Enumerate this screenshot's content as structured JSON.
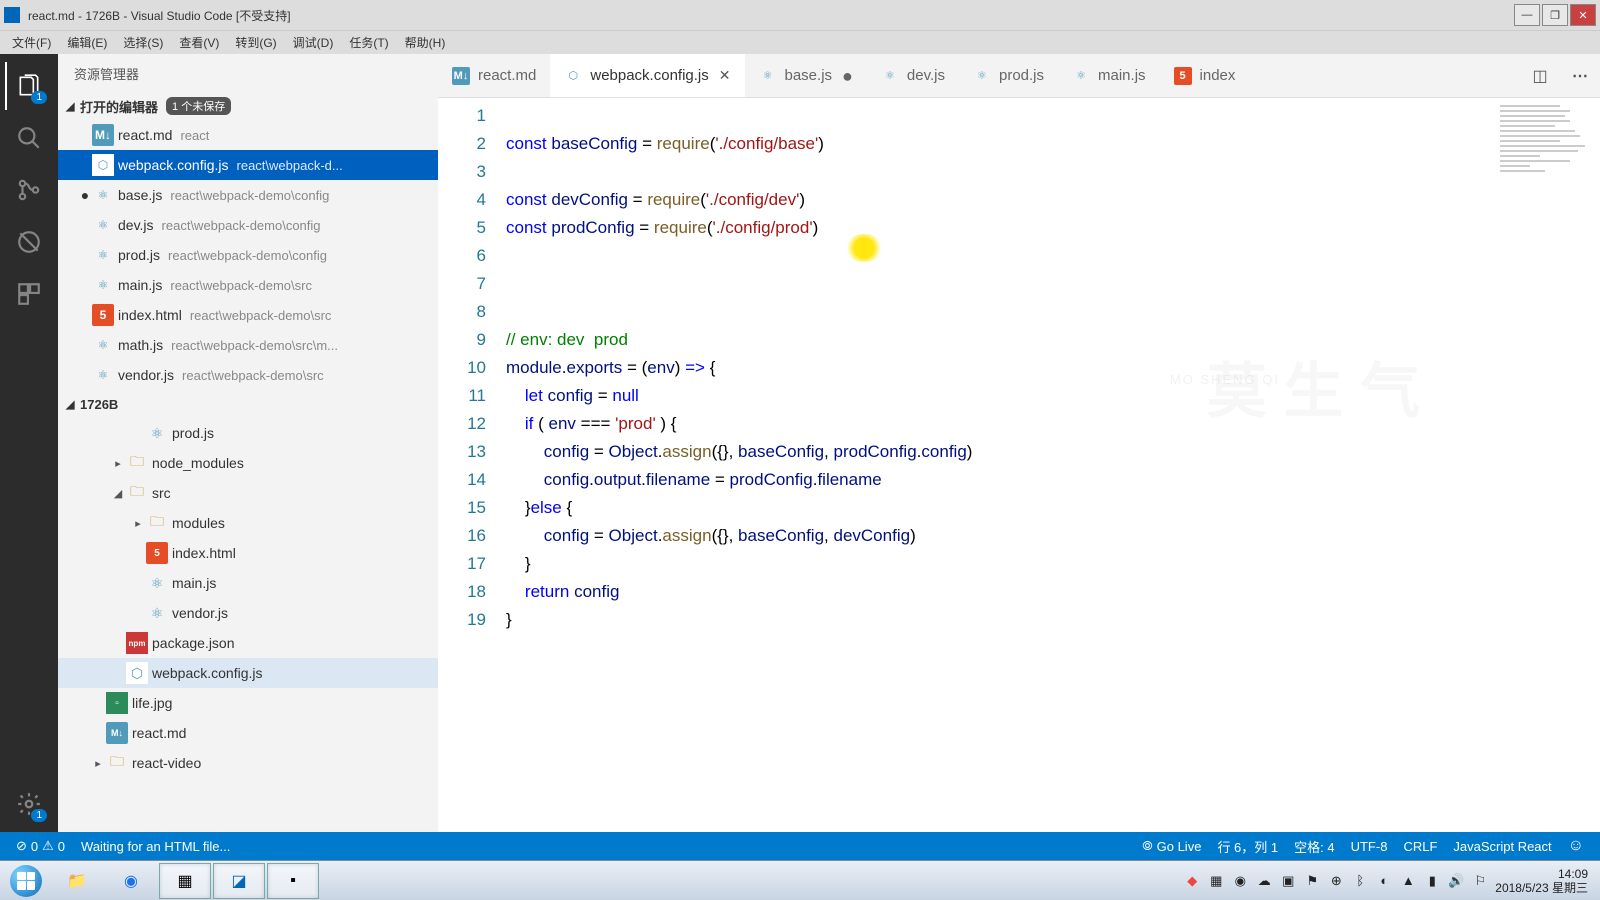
{
  "window": {
    "title": "react.md - 1726B - Visual Studio Code [不受支持]"
  },
  "menu": [
    "文件(F)",
    "编辑(E)",
    "选择(S)",
    "查看(V)",
    "转到(G)",
    "调试(D)",
    "任务(T)",
    "帮助(H)"
  ],
  "activity_badge": "1",
  "settings_badge": "1",
  "sidebar": {
    "title": "资源管理器",
    "open_editors_label": "打开的编辑器",
    "unsaved_badge": "1 个未保存",
    "open_editors": [
      {
        "name": "react.md",
        "path": "react",
        "icon": "md",
        "dirty": false
      },
      {
        "name": "webpack.config.js",
        "path": "react\\webpack-d...",
        "icon": "js",
        "dirty": false,
        "active": true
      },
      {
        "name": "base.js",
        "path": "react\\webpack-demo\\config",
        "icon": "react",
        "dirty": true
      },
      {
        "name": "dev.js",
        "path": "react\\webpack-demo\\config",
        "icon": "react",
        "dirty": false
      },
      {
        "name": "prod.js",
        "path": "react\\webpack-demo\\config",
        "icon": "react",
        "dirty": false
      },
      {
        "name": "main.js",
        "path": "react\\webpack-demo\\src",
        "icon": "react",
        "dirty": false
      },
      {
        "name": "index.html",
        "path": "react\\webpack-demo\\src",
        "icon": "html",
        "dirty": false
      },
      {
        "name": "math.js",
        "path": "react\\webpack-demo\\src\\m...",
        "icon": "react",
        "dirty": false
      },
      {
        "name": "vendor.js",
        "path": "react\\webpack-demo\\src",
        "icon": "react",
        "dirty": false
      }
    ],
    "project_label": "1726B",
    "tree": [
      {
        "indent": 3,
        "name": "prod.js",
        "icon": "react",
        "chev": ""
      },
      {
        "indent": 2,
        "name": "node_modules",
        "icon": "folder",
        "chev": "▸"
      },
      {
        "indent": 2,
        "name": "src",
        "icon": "folder",
        "chev": "◢"
      },
      {
        "indent": 3,
        "name": "modules",
        "icon": "folder",
        "chev": "▸"
      },
      {
        "indent": 3,
        "name": "index.html",
        "icon": "html",
        "chev": ""
      },
      {
        "indent": 3,
        "name": "main.js",
        "icon": "react",
        "chev": ""
      },
      {
        "indent": 3,
        "name": "vendor.js",
        "icon": "react",
        "chev": ""
      },
      {
        "indent": 2,
        "name": "package.json",
        "icon": "npm",
        "chev": ""
      },
      {
        "indent": 2,
        "name": "webpack.config.js",
        "icon": "js",
        "chev": "",
        "selected": true
      },
      {
        "indent": 1,
        "name": "life.jpg",
        "icon": "img",
        "chev": ""
      },
      {
        "indent": 1,
        "name": "react.md",
        "icon": "md",
        "chev": ""
      },
      {
        "indent": 1,
        "name": "react-video",
        "icon": "folder",
        "chev": "▸"
      }
    ]
  },
  "tabs": [
    {
      "label": "react.md",
      "icon": "md"
    },
    {
      "label": "webpack.config.js",
      "icon": "js-blue",
      "active": true,
      "close": true
    },
    {
      "label": "base.js",
      "icon": "react",
      "dirty": true
    },
    {
      "label": "dev.js",
      "icon": "react"
    },
    {
      "label": "prod.js",
      "icon": "react"
    },
    {
      "label": "main.js",
      "icon": "react"
    },
    {
      "label": "index",
      "icon": "html"
    }
  ],
  "code_lines": 19,
  "watermark": "莫 生 气",
  "watermark_sub": "MO SHENG QI",
  "statusbar": {
    "errors": "0",
    "warnings": "0",
    "message": "Waiting for an HTML file...",
    "golive": "Go Live",
    "ln": "行 6，列 1",
    "spaces": "空格: 4",
    "encoding": "UTF-8",
    "eol": "CRLF",
    "lang": "JavaScript React"
  },
  "clock": {
    "time": "14:09",
    "date": "2018/5/23 星期三"
  }
}
